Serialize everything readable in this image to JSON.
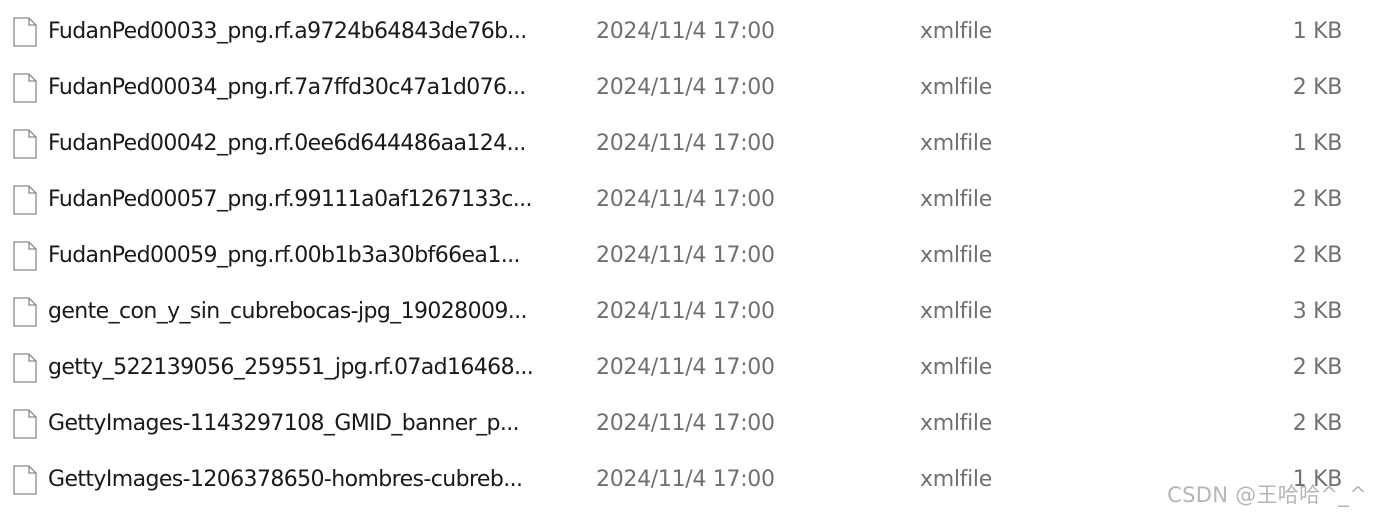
{
  "files": [
    {
      "name": "FudanPed00033_png.rf.a9724b64843de76b...",
      "modified": "2024/11/4 17:00",
      "type": "xmlfile",
      "size": "1 KB",
      "icon": "file-icon"
    },
    {
      "name": "FudanPed00034_png.rf.7a7ffd30c47a1d076...",
      "modified": "2024/11/4 17:00",
      "type": "xmlfile",
      "size": "2 KB",
      "icon": "file-icon"
    },
    {
      "name": "FudanPed00042_png.rf.0ee6d644486aa124...",
      "modified": "2024/11/4 17:00",
      "type": "xmlfile",
      "size": "1 KB",
      "icon": "file-icon"
    },
    {
      "name": "FudanPed00057_png.rf.99111a0af1267133c...",
      "modified": "2024/11/4 17:00",
      "type": "xmlfile",
      "size": "2 KB",
      "icon": "file-icon"
    },
    {
      "name": "FudanPed00059_png.rf.00b1b3a30bf66ea1...",
      "modified": "2024/11/4 17:00",
      "type": "xmlfile",
      "size": "2 KB",
      "icon": "file-icon"
    },
    {
      "name": "gente_con_y_sin_cubrebocas-jpg_19028009...",
      "modified": "2024/11/4 17:00",
      "type": "xmlfile",
      "size": "3 KB",
      "icon": "file-icon"
    },
    {
      "name": "getty_522139056_259551_jpg.rf.07ad16468...",
      "modified": "2024/11/4 17:00",
      "type": "xmlfile",
      "size": "2 KB",
      "icon": "file-icon"
    },
    {
      "name": "GettyImages-1143297108_GMID_banner_p...",
      "modified": "2024/11/4 17:00",
      "type": "xmlfile",
      "size": "2 KB",
      "icon": "file-icon"
    },
    {
      "name": "GettyImages-1206378650-hombres-cubreb...",
      "modified": "2024/11/4 17:00",
      "type": "xmlfile",
      "size": "1 KB",
      "icon": "file-icon"
    }
  ],
  "watermark": "CSDN @王哈哈^_^",
  "colors": {
    "name_text": "#1a1a1a",
    "meta_text": "#707070",
    "icon_stroke": "#8a8a8a",
    "background": "#ffffff"
  }
}
